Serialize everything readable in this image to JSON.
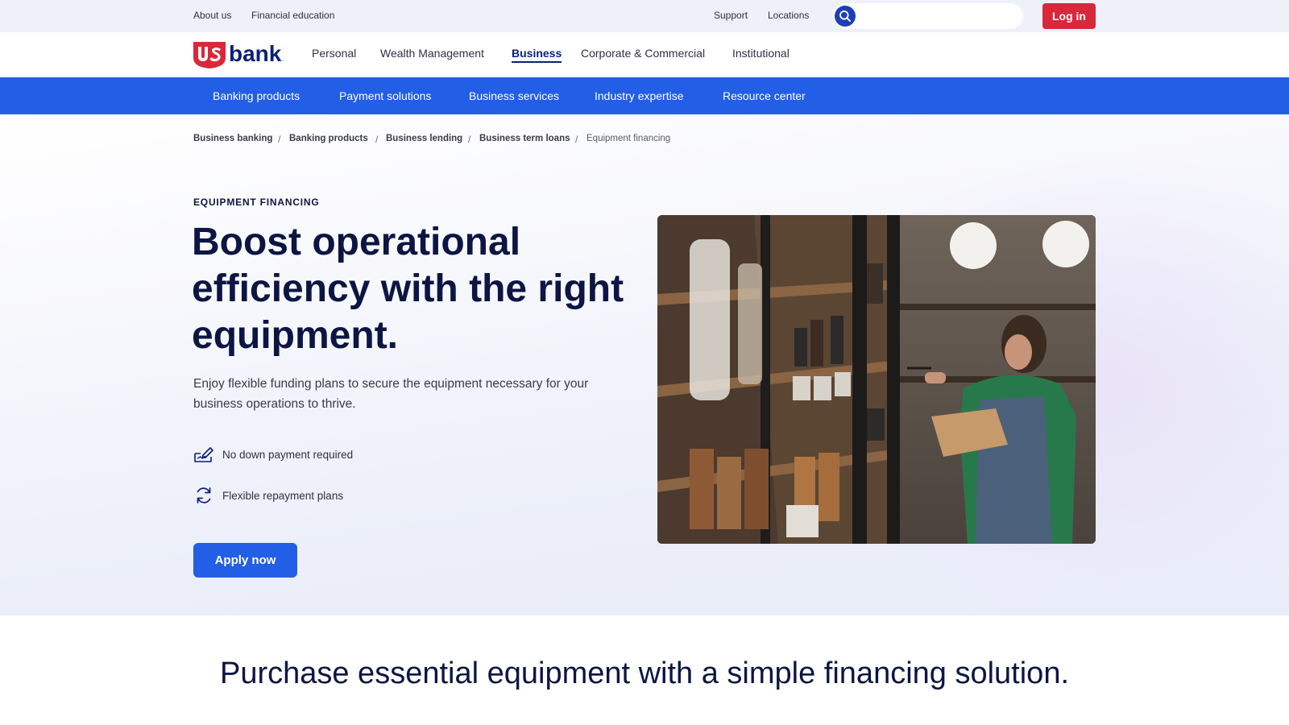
{
  "utility": {
    "about": "About us",
    "education": "Financial education",
    "support": "Support",
    "locations": "Locations",
    "login": "Log in"
  },
  "brand": {
    "logo_icon": "us-bank-logo",
    "red": "#d9283a",
    "navy": "#0c1f7a",
    "blue": "#235ee6"
  },
  "mainnav": {
    "items": [
      "Personal",
      "Wealth Management",
      "Business",
      "Corporate & Commercial",
      "Institutional"
    ],
    "active": "Business"
  },
  "subnav": {
    "items": [
      "Banking products",
      "Payment solutions",
      "Business services",
      "Industry expertise",
      "Resource center"
    ]
  },
  "breadcrumb": [
    "Business banking",
    "Banking products",
    "Business lending",
    "Business term loans",
    "Equipment financing"
  ],
  "hero": {
    "eyebrow": "EQUIPMENT FINANCING",
    "headline": "Boost operational efficiency with the right equipment.",
    "lead": "Enjoy flexible funding plans to secure the equipment necessary for your business operations to thrive.",
    "features": [
      {
        "icon": "signing-document-icon",
        "text": "No down payment required"
      },
      {
        "icon": "refresh-arrows-icon",
        "text": "Flexible repayment plans"
      }
    ],
    "cta": "Apply now",
    "image": "woman-with-clipboard-checking-shop-shelves-photo"
  },
  "section": {
    "title": "Purchase essential equipment with a simple financing solution."
  }
}
